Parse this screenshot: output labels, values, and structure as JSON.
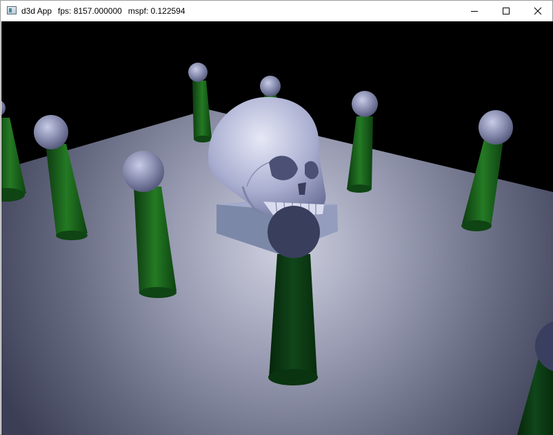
{
  "window": {
    "app_name": "d3d App",
    "fps_text": "fps: 8157.000000",
    "mspf_text": "mspf: 0.122594",
    "icon": "app-window-icon",
    "buttons": {
      "minimize": "minimize-icon",
      "maximize": "maximize-icon",
      "close": "close-icon"
    }
  },
  "scene": {
    "background_color": "#000000",
    "floor_color": "#6f7389",
    "column_color": "#1f6a1f",
    "sphere_color": "#8a90b4",
    "skull_color": "#b3b8d6",
    "box_color": "#7c88a8"
  }
}
